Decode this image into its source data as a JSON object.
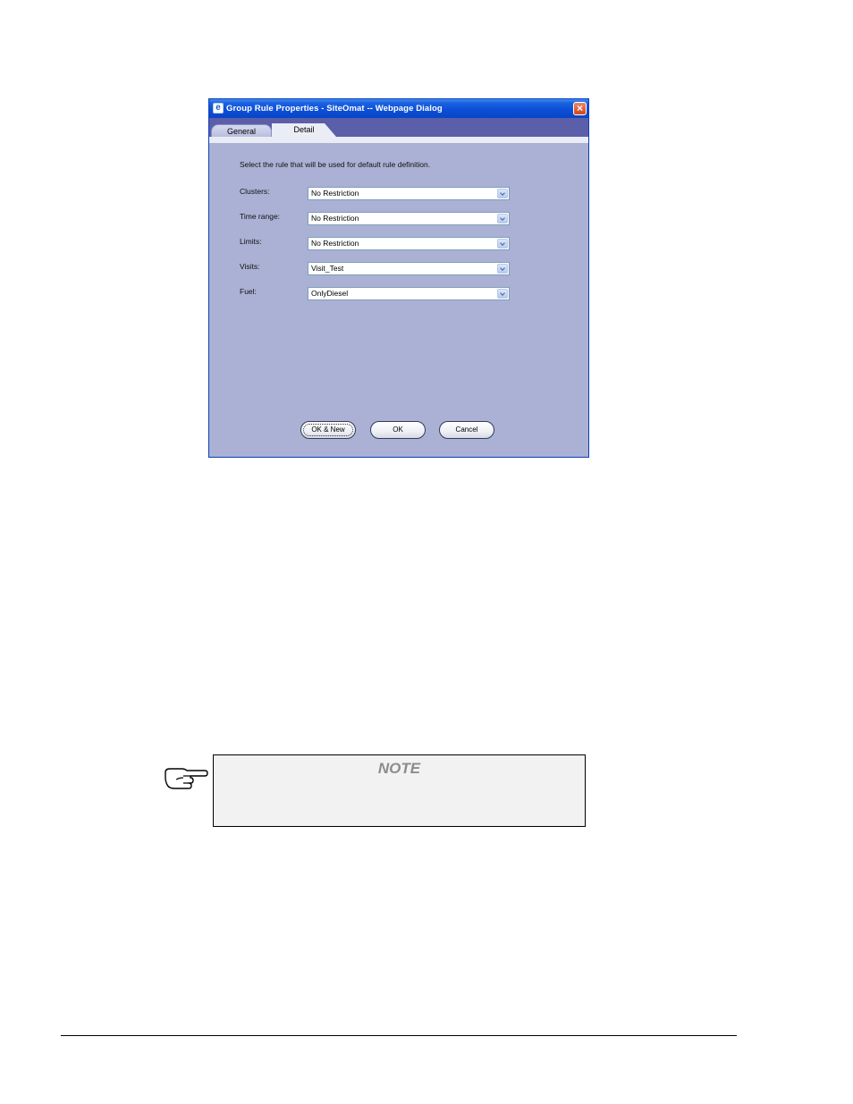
{
  "dialog": {
    "title": "Group Rule Properties - SiteOmat -- Webpage Dialog",
    "close_glyph": "×",
    "icon": "ie-page-icon",
    "tabs": [
      {
        "label": "General",
        "active": false
      },
      {
        "label": "Detail",
        "active": true
      }
    ],
    "instruction": "Select the rule that will be used for default rule definition.",
    "fields": [
      {
        "label": "Clusters:",
        "value": "No Restriction"
      },
      {
        "label": "Time range:",
        "value": "No Restriction"
      },
      {
        "label": "Limits:",
        "value": "No Restriction"
      },
      {
        "label": "Visits:",
        "value": "Visit_Test"
      },
      {
        "label": "Fuel:",
        "value": "OnlyDiesel"
      }
    ],
    "buttons": {
      "ok_new": "OK & New",
      "ok": "OK",
      "cancel": "Cancel"
    },
    "colors": {
      "titlebar": "#0b4fd8",
      "body": "#aab1d4",
      "tabbar": "#5b5faa"
    }
  },
  "note": {
    "title": "NOTE",
    "icon": "pointing-hand-icon"
  }
}
